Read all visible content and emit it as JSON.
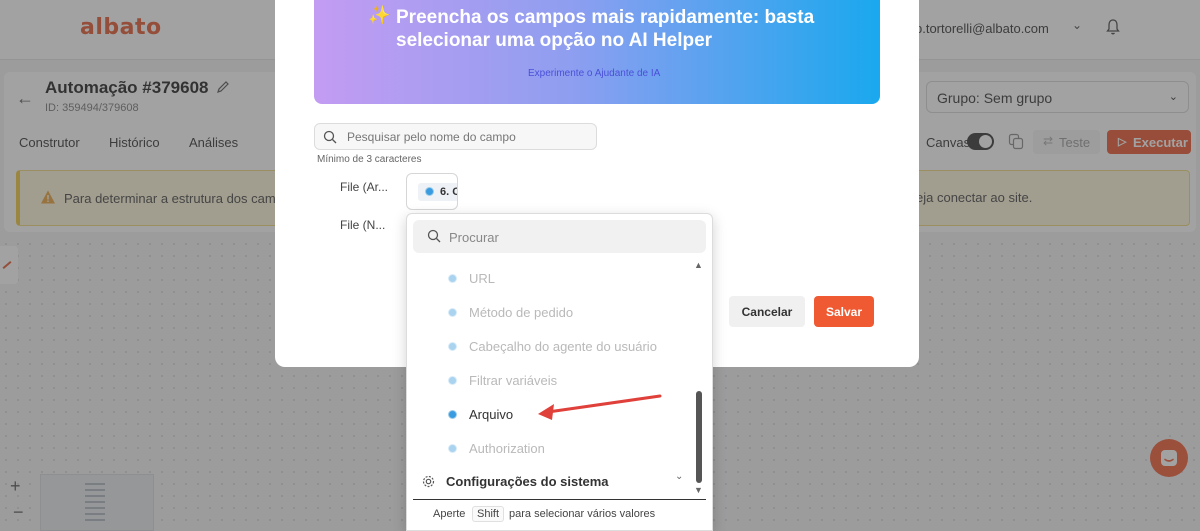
{
  "app": {
    "logo": "albato",
    "user_email": "p.tortorelli@albato.com"
  },
  "automation": {
    "title": "Automação #379608",
    "id_text": "ID: 359494/379608",
    "group_select": "Grupo: Sem grupo"
  },
  "tabs": [
    "Construtor",
    "Histórico",
    "Análises"
  ],
  "toolbar": {
    "canvas_label": "Canvas",
    "test_label": "Teste",
    "run_label": "Executar"
  },
  "warning": {
    "text_start": "Para determinar a estrutura dos camp",
    "text_end": "eja conectar ao site."
  },
  "modal": {
    "ai_banner": {
      "title": "Preencha os campos mais rapidamente: basta selecionar uma opção no AI Helper",
      "link": "Experimente o Ajudante de IA"
    },
    "field_search": {
      "placeholder": "Pesquisar pelo nome do campo",
      "hint": "Mínimo de 3 caracteres"
    },
    "fields": [
      {
        "label": "File (Ar...",
        "chip": "6. C"
      },
      {
        "label": "File (N..."
      }
    ],
    "cancel_label": "Cancelar",
    "save_label": "Salvar"
  },
  "dropdown": {
    "search_placeholder": "Procurar",
    "items": [
      {
        "label": "URL",
        "active": false
      },
      {
        "label": "Método de pedido",
        "active": false
      },
      {
        "label": "Cabeçalho do agente do usuário",
        "active": false
      },
      {
        "label": "Filtrar variáveis",
        "active": false
      },
      {
        "label": "Arquivo",
        "active": true
      },
      {
        "label": "Authorization",
        "active": false
      }
    ],
    "section_label": "Configurações do sistema",
    "footer": {
      "press": "Aperte",
      "key": "Shift",
      "rest": "para selecionar vários valores"
    }
  },
  "icons": {
    "ai": "sparkle-icon",
    "search": "search-icon",
    "settings": "gear-icon",
    "notifications": "bell-icon",
    "edit": "pencil-icon",
    "warning": "warning-icon",
    "chat": "chat-icon"
  },
  "colors": {
    "brand": "#e2562c",
    "primary_button": "#f05a32",
    "warning_bg": "#fcf5d8",
    "option_dot": "#3a9ce0"
  }
}
